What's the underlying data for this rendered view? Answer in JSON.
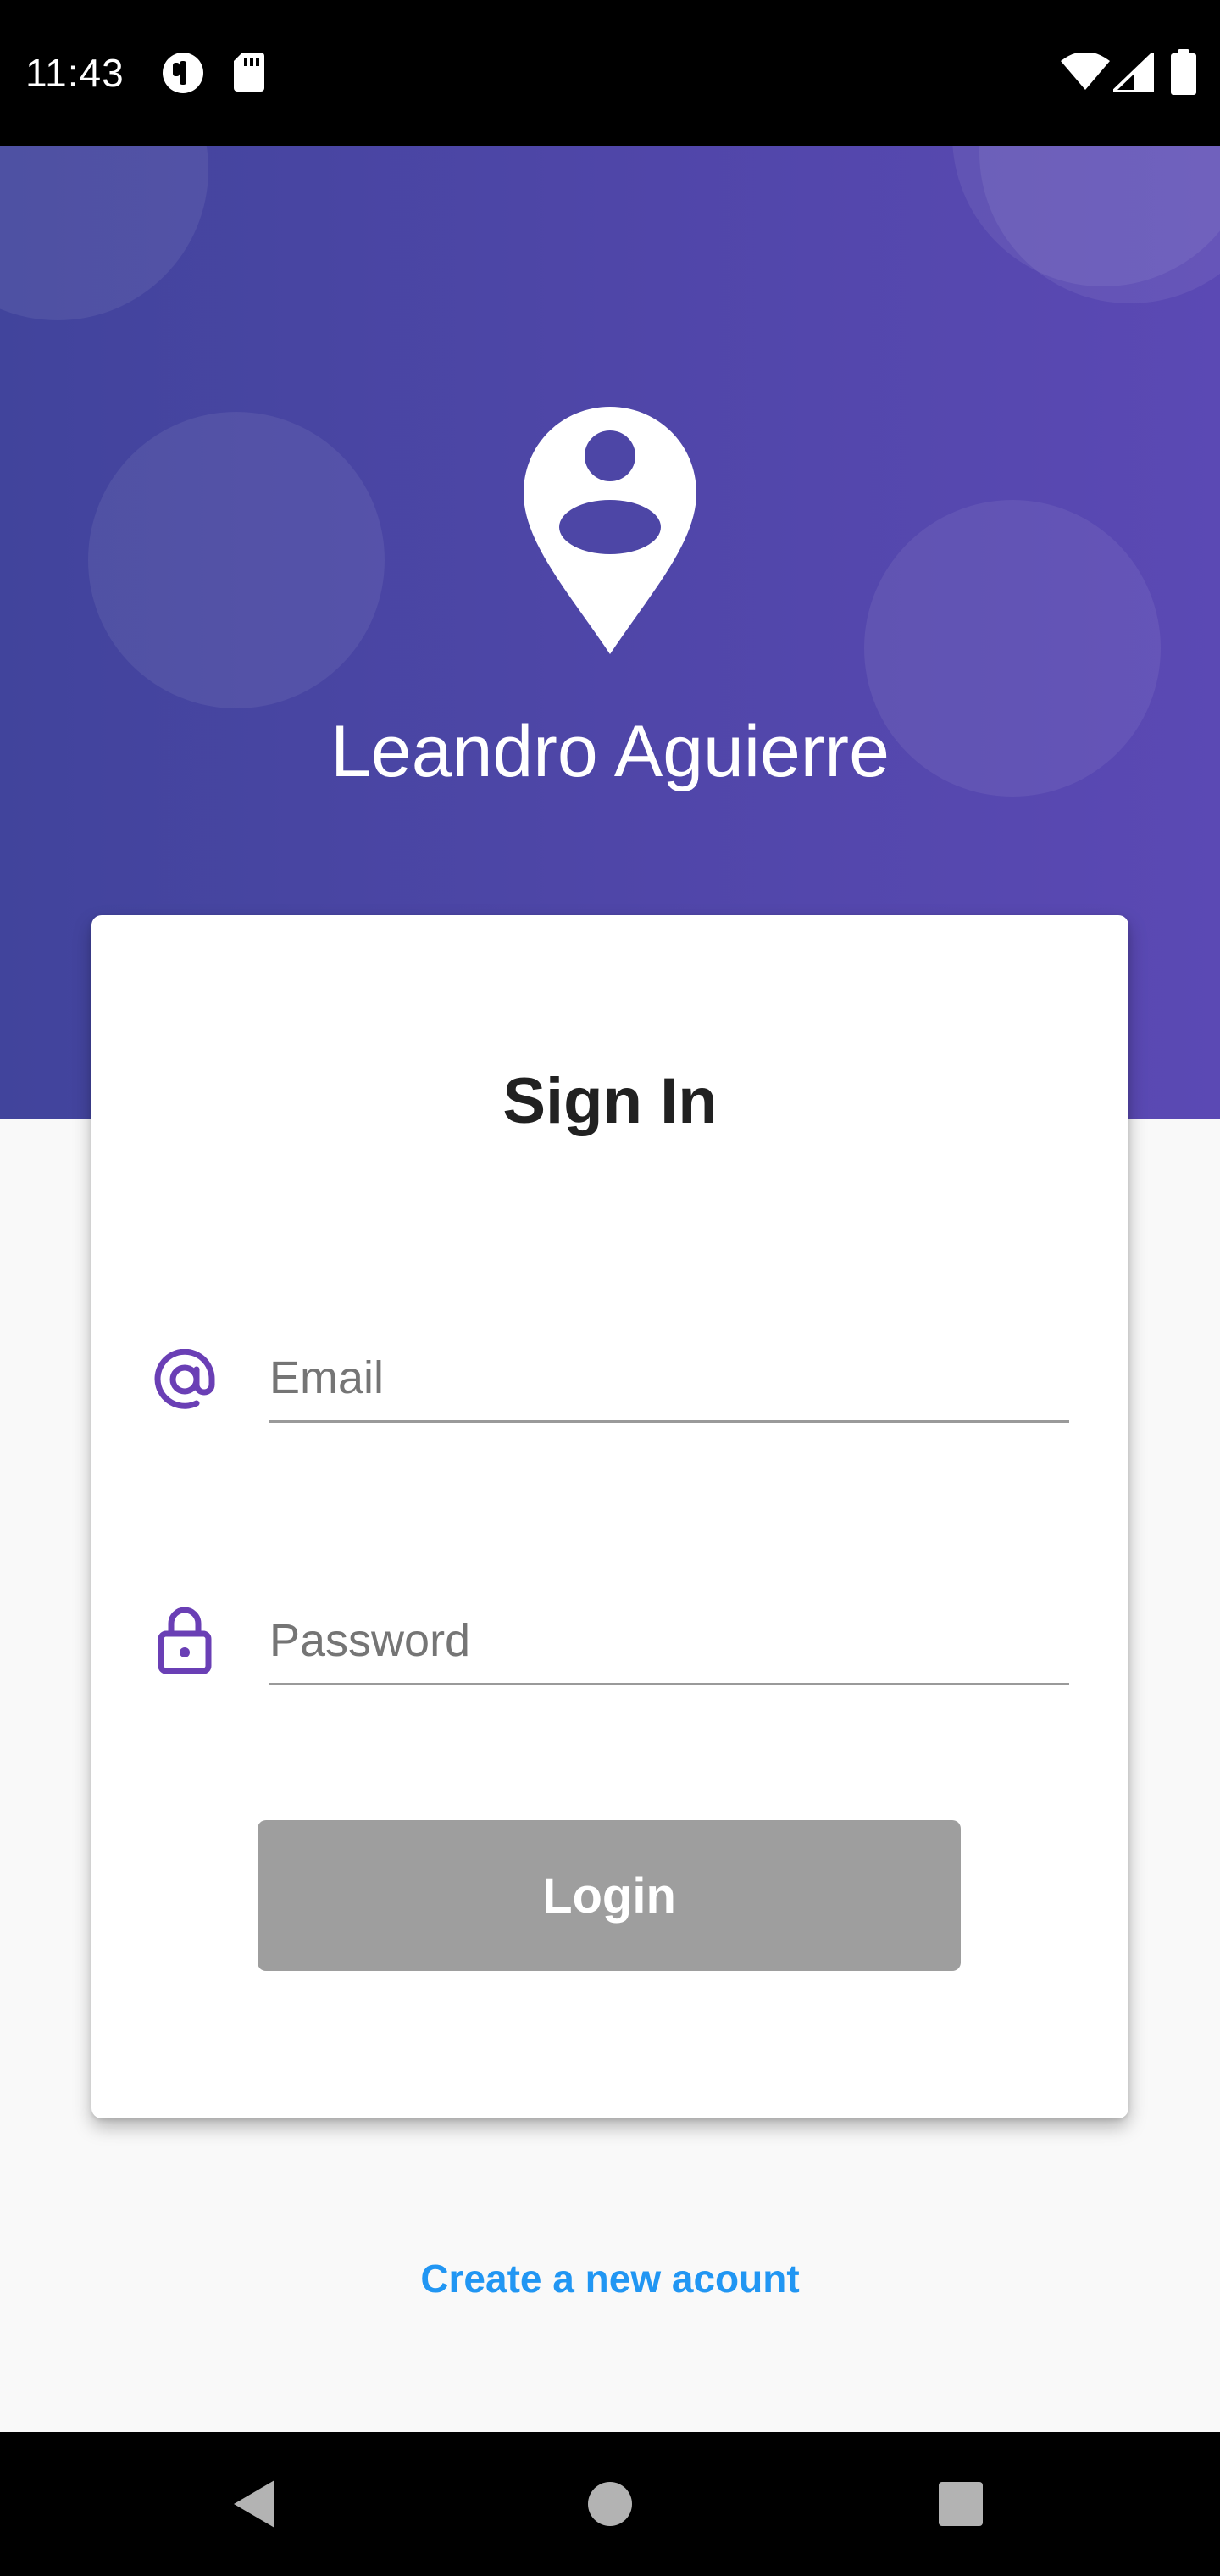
{
  "status_bar": {
    "time": "11:43",
    "left_icons": [
      "notification-app-icon",
      "sd-card-icon"
    ],
    "right_icons": [
      "wifi-icon",
      "cellular-signal-icon",
      "battery-icon"
    ]
  },
  "header": {
    "logo_icon": "person-location-pin-icon",
    "app_name": "Leandro Aguierre"
  },
  "login_card": {
    "title": "Sign In",
    "email": {
      "icon": "at-sign-icon",
      "placeholder": "Email",
      "value": ""
    },
    "password": {
      "icon": "lock-icon",
      "placeholder": "Password",
      "value": ""
    },
    "login_button_label": "Login"
  },
  "create_account_link": "Create a new acount",
  "nav_bar": {
    "buttons": [
      "back-icon",
      "home-icon",
      "recents-icon"
    ]
  },
  "colors": {
    "header_gradient_start": "#41449c",
    "header_gradient_end": "#5b49b4",
    "icon_accent": "#6a3fb5",
    "button_disabled": "#9e9e9e",
    "link": "#2196f3",
    "background": "#f9f9f9"
  }
}
